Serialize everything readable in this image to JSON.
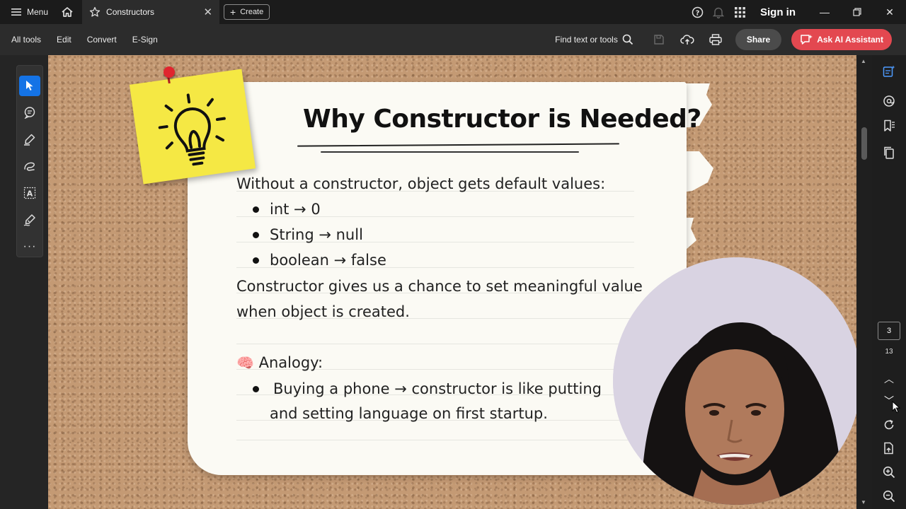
{
  "titlebar": {
    "menu_label": "Menu",
    "tab_title": "Constructors",
    "create_label": "Create",
    "signin_label": "Sign in"
  },
  "toolbar": {
    "items": [
      "All tools",
      "Edit",
      "Convert",
      "E-Sign"
    ],
    "find_label": "Find text or tools",
    "share_label": "Share",
    "ai_label": "Ask AI Assistant"
  },
  "left_tools": [
    "select-cursor-icon",
    "comment-icon",
    "highlight-pen-icon",
    "draw-freehand-icon",
    "text-select-box-icon",
    "sign-pen-icon",
    "more-icon"
  ],
  "document": {
    "title": "Why Constructor is Needed?",
    "intro": "Without a constructor, object gets default values:",
    "defaults": [
      "int → 0",
      "String → null",
      "boolean → false"
    ],
    "explanation_line1": "Constructor gives us a chance to set meaningful value",
    "explanation_line2": "when object is created.",
    "analogy_emoji": "🧠",
    "analogy_heading": "Analogy:",
    "analogy_line1": "Buying a phone → constructor is like putting",
    "analogy_line2": "and setting language on first startup."
  },
  "pagination": {
    "current_page": "3",
    "total_pages": "13"
  },
  "colors": {
    "accent_blue": "#1473e6",
    "ai_button": "#e34850",
    "sticky_note": "#f5e844",
    "cork": "#c49a74"
  }
}
